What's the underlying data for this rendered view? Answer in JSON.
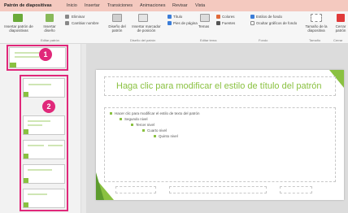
{
  "tabs": [
    {
      "label": "Patrón de diapositivas",
      "active": true
    },
    {
      "label": "Inicio"
    },
    {
      "label": "Insertar"
    },
    {
      "label": "Transiciones"
    },
    {
      "label": "Animaciones"
    },
    {
      "label": "Revisar"
    },
    {
      "label": "Vista"
    }
  ],
  "ribbon": {
    "insert_master": "Insertar patrón de diapositivas",
    "insert_layout": "Insertar diseño",
    "delete": "Eliminar",
    "rename": "Cambiar nombre",
    "preserve": "Diseño del patrón",
    "insert_placeholder": "Insertar marcador de posición",
    "title_check": "Título",
    "footers_check": "Pies de página",
    "themes": "Temas",
    "colors": "Colores",
    "fonts": "Fuentes",
    "background_styles": "Estilos de fondo",
    "hide_bg": "Ocultar gráficos de fondo",
    "slide_size": "Tamaño de la diapositiva",
    "close_master": "Cerrar patrón",
    "group_edit_master": "Editar patrón",
    "group_master_layout": "Diseño del patrón",
    "group_theme": "Editar tema",
    "group_background": "Fondo",
    "group_size": "Tamaño",
    "group_close": "Cerrar"
  },
  "badges": {
    "one": "1",
    "two": "2"
  },
  "slide": {
    "title": "Haga clic para modificar el estilo de título del patrón",
    "level1": "Hacer clic para modificar el estilo de texto del patrón",
    "level2": "Segundo nivel",
    "level3": "Tercer nivel",
    "level4": "Cuarto nivel",
    "level5": "Quinto nivel"
  },
  "colors": {
    "accent": "#8ac141",
    "highlight": "#e0287a",
    "tabbar": "#f4c9bf"
  }
}
